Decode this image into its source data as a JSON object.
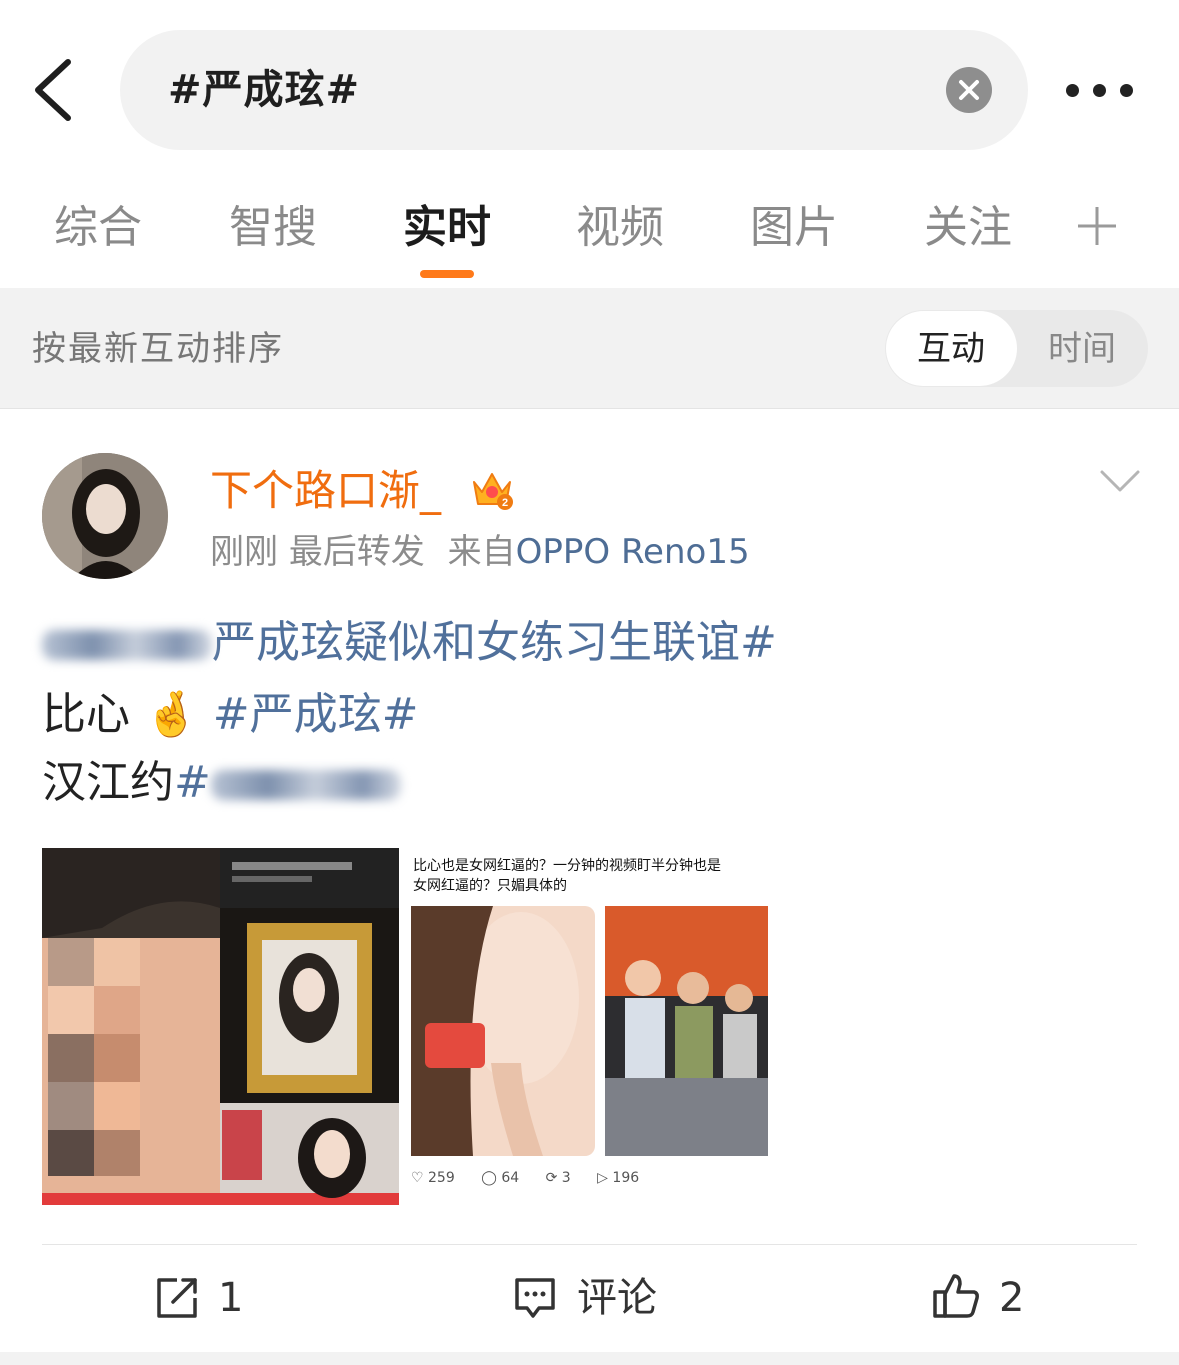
{
  "search": {
    "query": "#严成玹#"
  },
  "tabs": [
    {
      "label": "综合"
    },
    {
      "label": "智搜"
    },
    {
      "label": "实时"
    },
    {
      "label": "视频"
    },
    {
      "label": "图片"
    },
    {
      "label": "关注"
    }
  ],
  "sort": {
    "label": "按最新互动排序",
    "options": [
      "互动",
      "时间"
    ],
    "selected": "互动"
  },
  "post": {
    "username": "下个路口渐_",
    "time": "刚刚",
    "action": "最后转发",
    "source_prefix": "来自",
    "device": "OPPO Reno15",
    "line1_topic_tail": "严成玹疑似和女练习生联谊#",
    "line2_text": "比心",
    "line2_emoji": "🤞",
    "line2_topic": "#严成玹#",
    "line3_text": "汉江约",
    "line3_topic_head": "#",
    "screenshot": {
      "caption_line1": "比心也是女网红逼的？一分钟的视频盯半分钟也是",
      "caption_line2": "女网红逼的？只媚具体的",
      "likes": "259",
      "comments": "64",
      "reposts": "3",
      "shares": "196"
    }
  },
  "actions": {
    "repost_count": "1",
    "comment_label": "评论",
    "like_count": "2"
  },
  "colors": {
    "accent": "#ff7a1a",
    "username": "#f06d0f",
    "topic_link": "#50709b"
  }
}
